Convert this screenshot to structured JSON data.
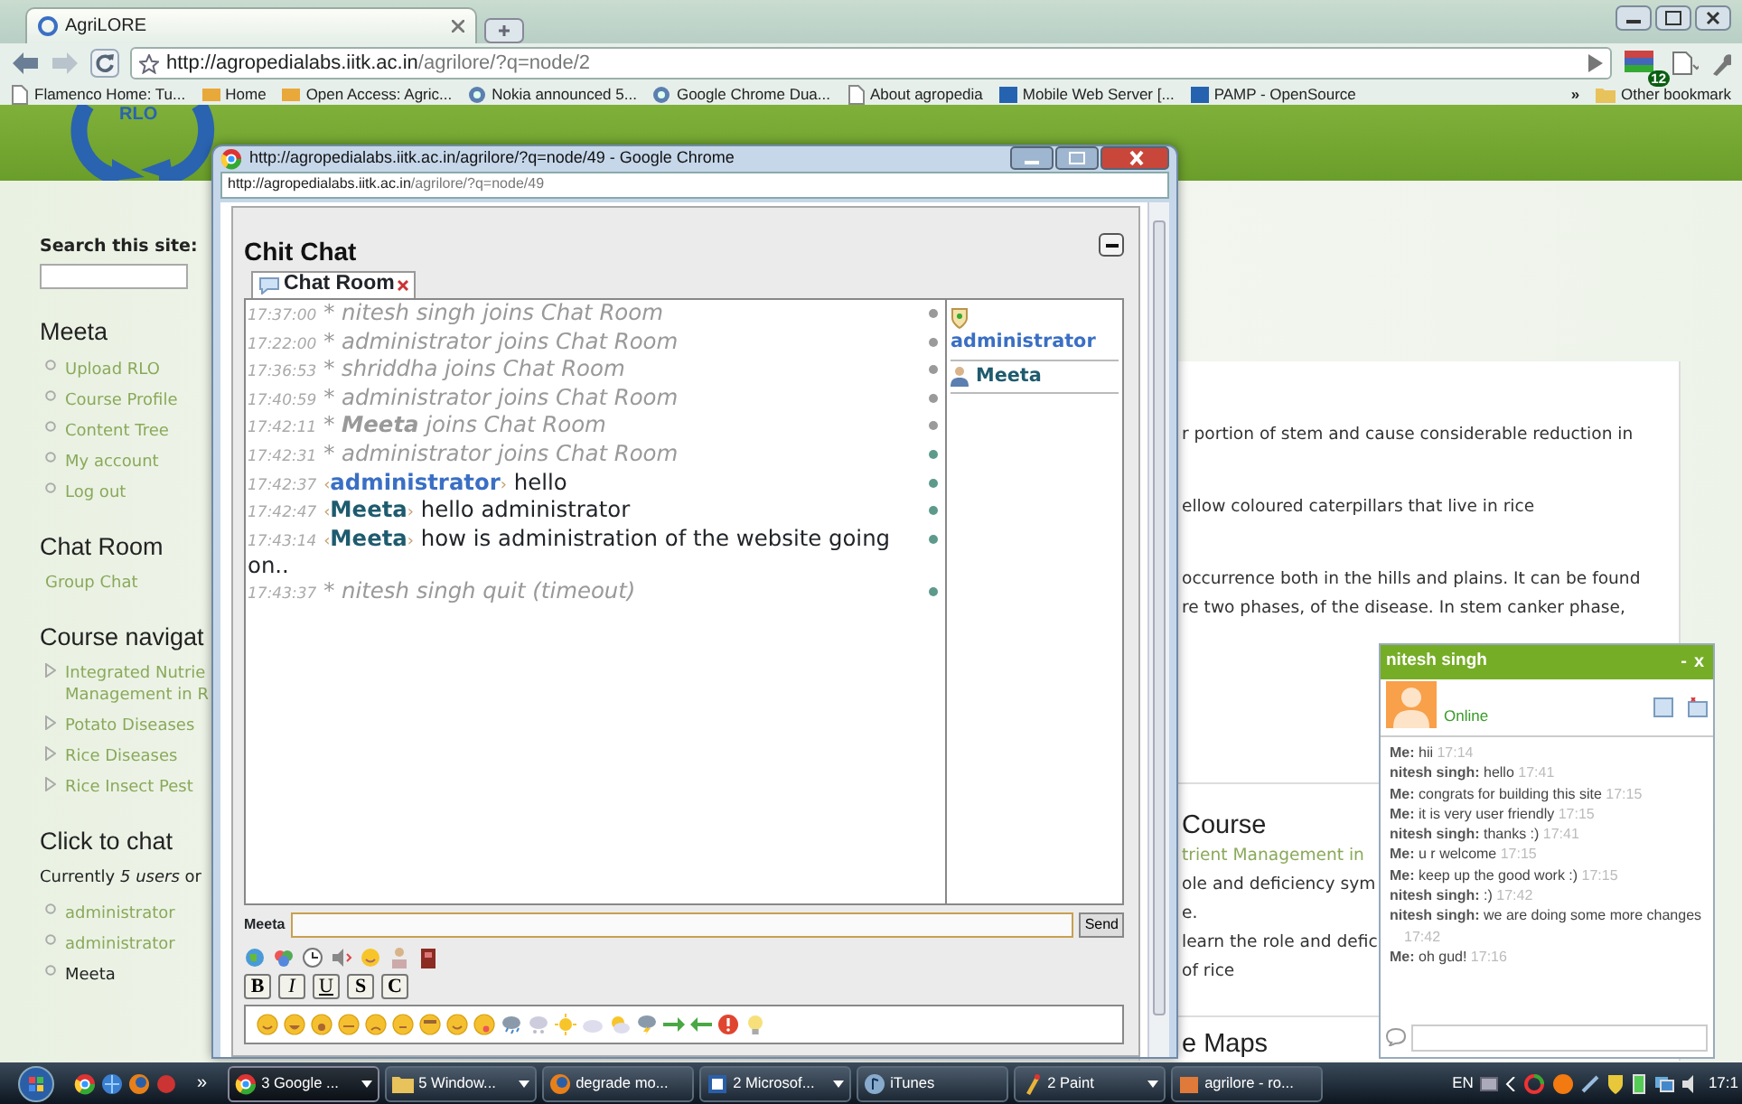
{
  "browser": {
    "tabs": [
      {
        "label": "AgriLORE",
        "selected": true
      }
    ],
    "url_host": "http://agropedialabs.iitk.ac.in",
    "url_path": "/agrilore/?q=node/2",
    "extension_badge": "12",
    "bookmarks": [
      "Flamenco Home: Tu...",
      "Home",
      "Open Access: Agric...",
      "Nokia announced 5...",
      "Google Chrome Dua...",
      "About agropedia",
      "Mobile Web Server [...",
      "PAMP - OpenSource"
    ],
    "more": "»",
    "other_bookmarks": "Other bookmark"
  },
  "logo_text": "RLO",
  "sidebar": {
    "search_label": "Search this site:",
    "sections": [
      {
        "title": "Meeta",
        "items": [
          {
            "lines": [
              "Upload RLO"
            ],
            "kind": "circle",
            "link": true
          },
          {
            "lines": [
              "Course Profile"
            ],
            "kind": "circle",
            "link": true
          },
          {
            "lines": [
              "Content Tree"
            ],
            "kind": "circle",
            "link": true
          },
          {
            "lines": [
              "My account"
            ],
            "kind": "circle",
            "link": true
          },
          {
            "lines": [
              "Log out"
            ],
            "kind": "circle",
            "link": true
          }
        ]
      },
      {
        "title": "Chat Room",
        "items": [
          {
            "lines": [
              "Group Chat"
            ],
            "kind": "plain",
            "link": true
          }
        ]
      },
      {
        "title": "Course navigat",
        "items": [
          {
            "lines": [
              "Integrated Nutrie",
              "Management in R"
            ],
            "kind": "triangle",
            "link": true
          },
          {
            "lines": [
              "Potato Diseases"
            ],
            "kind": "triangle",
            "link": true
          },
          {
            "lines": [
              "Rice Diseases"
            ],
            "kind": "triangle",
            "link": true
          },
          {
            "lines": [
              "Rice Insect Pest"
            ],
            "kind": "triangle",
            "link": true
          }
        ]
      },
      {
        "title": "Click to chat",
        "note": "Currently *5 users* or",
        "items": [
          {
            "lines": [
              "administrator"
            ],
            "kind": "circle",
            "link": true
          },
          {
            "lines": [
              "administrator"
            ],
            "kind": "circle",
            "link": true
          },
          {
            "lines": [
              "Meeta"
            ],
            "kind": "circle",
            "link": false
          }
        ]
      }
    ]
  },
  "content": {
    "blocks": [
      {
        "kind": "paragraph",
        "lines": [
          "r portion of stem and cause considerable reduction in"
        ]
      },
      {
        "kind": "paragraph",
        "lines": [
          "ellow coloured caterpillars that live in rice"
        ]
      },
      {
        "kind": "paragraph",
        "lines": [
          "occurrence both in the hills and plains. It can be found",
          "re two phases, of the disease. In stem canker phase,"
        ]
      },
      {
        "kind": "divider"
      },
      {
        "kind": "heading",
        "text": "Course"
      },
      {
        "kind": "link",
        "text": "trient Management in"
      },
      {
        "kind": "paragraph",
        "lines": [
          "ole and deficiency sym",
          "e.",
          "learn the role and defic",
          "of rice"
        ]
      },
      {
        "kind": "divider"
      },
      {
        "kind": "heading",
        "text": "e Maps"
      }
    ]
  },
  "popup": {
    "title": "http://agropedialabs.iitk.ac.in/agrilore/?q=node/49 - Google Chrome",
    "url_host": "http://agropedialabs.iitk.ac.in",
    "url_path": "/agrilore/?q=node/49",
    "chat": {
      "title": "Chit Chat",
      "tab": "Chat Room",
      "messages": [
        {
          "kind": "event",
          "time": "17:37:00",
          "text": "* nitesh singh joins Chat Room",
          "color": "#9a9a9a"
        },
        {
          "kind": "event",
          "time": "17:22:00",
          "text": "* administrator joins Chat Room",
          "color": "#9a9a9a"
        },
        {
          "kind": "event",
          "time": "17:36:53",
          "text": "* shriddha joins Chat Room",
          "color": "#9a9a9a"
        },
        {
          "kind": "event",
          "time": "17:40:59",
          "text": "* administrator joins Chat Room",
          "color": "#9a9a9a"
        },
        {
          "kind": "event",
          "time": "17:42:11",
          "text": "* **Meeta** joins Chat Room",
          "color": "#9a9a9a"
        },
        {
          "kind": "event",
          "time": "17:42:31",
          "text": "* administrator joins Chat Room",
          "color": "#5e9a8c"
        },
        {
          "kind": "message",
          "time": "17:42:37",
          "open": "‹",
          "author": "administrator",
          "close": "›",
          "admin": true,
          "text": "hello",
          "color": "#5e9a8c"
        },
        {
          "kind": "message",
          "time": "17:42:47",
          "open": "‹",
          "author": "Meeta",
          "close": "›",
          "admin": false,
          "text": "hello administrator",
          "color": "#5e9a8c"
        },
        {
          "kind": "message",
          "time": "17:43:14",
          "open": "‹",
          "author": "Meeta",
          "close": "›",
          "admin": false,
          "text": "how is administration of the website going on..",
          "color": "#5e9a8c"
        },
        {
          "kind": "event",
          "time": "17:43:37",
          "text": "* nitesh singh quit (timeout)",
          "color": "#5e9a8c"
        }
      ],
      "users": [
        {
          "name": "administrator",
          "admin": true
        },
        {
          "name": "Meeta",
          "admin": false
        }
      ],
      "input_label": "Meeta",
      "send": "Send",
      "formats": [
        "B",
        "I",
        "U",
        "S",
        "C"
      ]
    }
  },
  "im": {
    "name": "nitesh singh",
    "minimize": "-",
    "close": "x",
    "status": "Online",
    "messages": [
      {
        "from": "Me:",
        "text": "hii",
        "time": "17:14"
      },
      {
        "from": "nitesh singh:",
        "text": "hello",
        "time": "17:41"
      },
      {
        "from": "Me:",
        "text": "congrats for building this site",
        "time": "17:15"
      },
      {
        "from": "Me:",
        "text": "it is very user friendly",
        "time": "17:15"
      },
      {
        "from": "nitesh singh:",
        "text": "thanks :)",
        "time": "17:41"
      },
      {
        "from": "Me:",
        "text": "u r welcome",
        "time": "17:15"
      },
      {
        "from": "Me:",
        "text": "keep up the good work :)",
        "time": "17:15"
      },
      {
        "from": "nitesh singh:",
        "text": ":)",
        "time": "17:42"
      },
      {
        "from": "nitesh singh:",
        "text": "we are doing some more changes",
        "time": "17:42"
      },
      {
        "from": "Me:",
        "text": "oh gud!",
        "time": "17:16"
      }
    ]
  },
  "taskbar": {
    "more": "»",
    "buttons": [
      {
        "label": "3 Google ...",
        "menu": true,
        "selected": true
      },
      {
        "label": "5 Window...",
        "menu": true,
        "selected": false
      },
      {
        "label": "degrade mo...",
        "menu": false,
        "selected": false
      },
      {
        "label": "2 Microsof...",
        "menu": true,
        "selected": false
      },
      {
        "label": "iTunes",
        "menu": false,
        "selected": false
      },
      {
        "label": "2 Paint",
        "menu": true,
        "selected": false
      },
      {
        "label": "agrilore - ro...",
        "menu": false,
        "selected": false
      }
    ],
    "language": "EN",
    "clock": "17:1"
  }
}
